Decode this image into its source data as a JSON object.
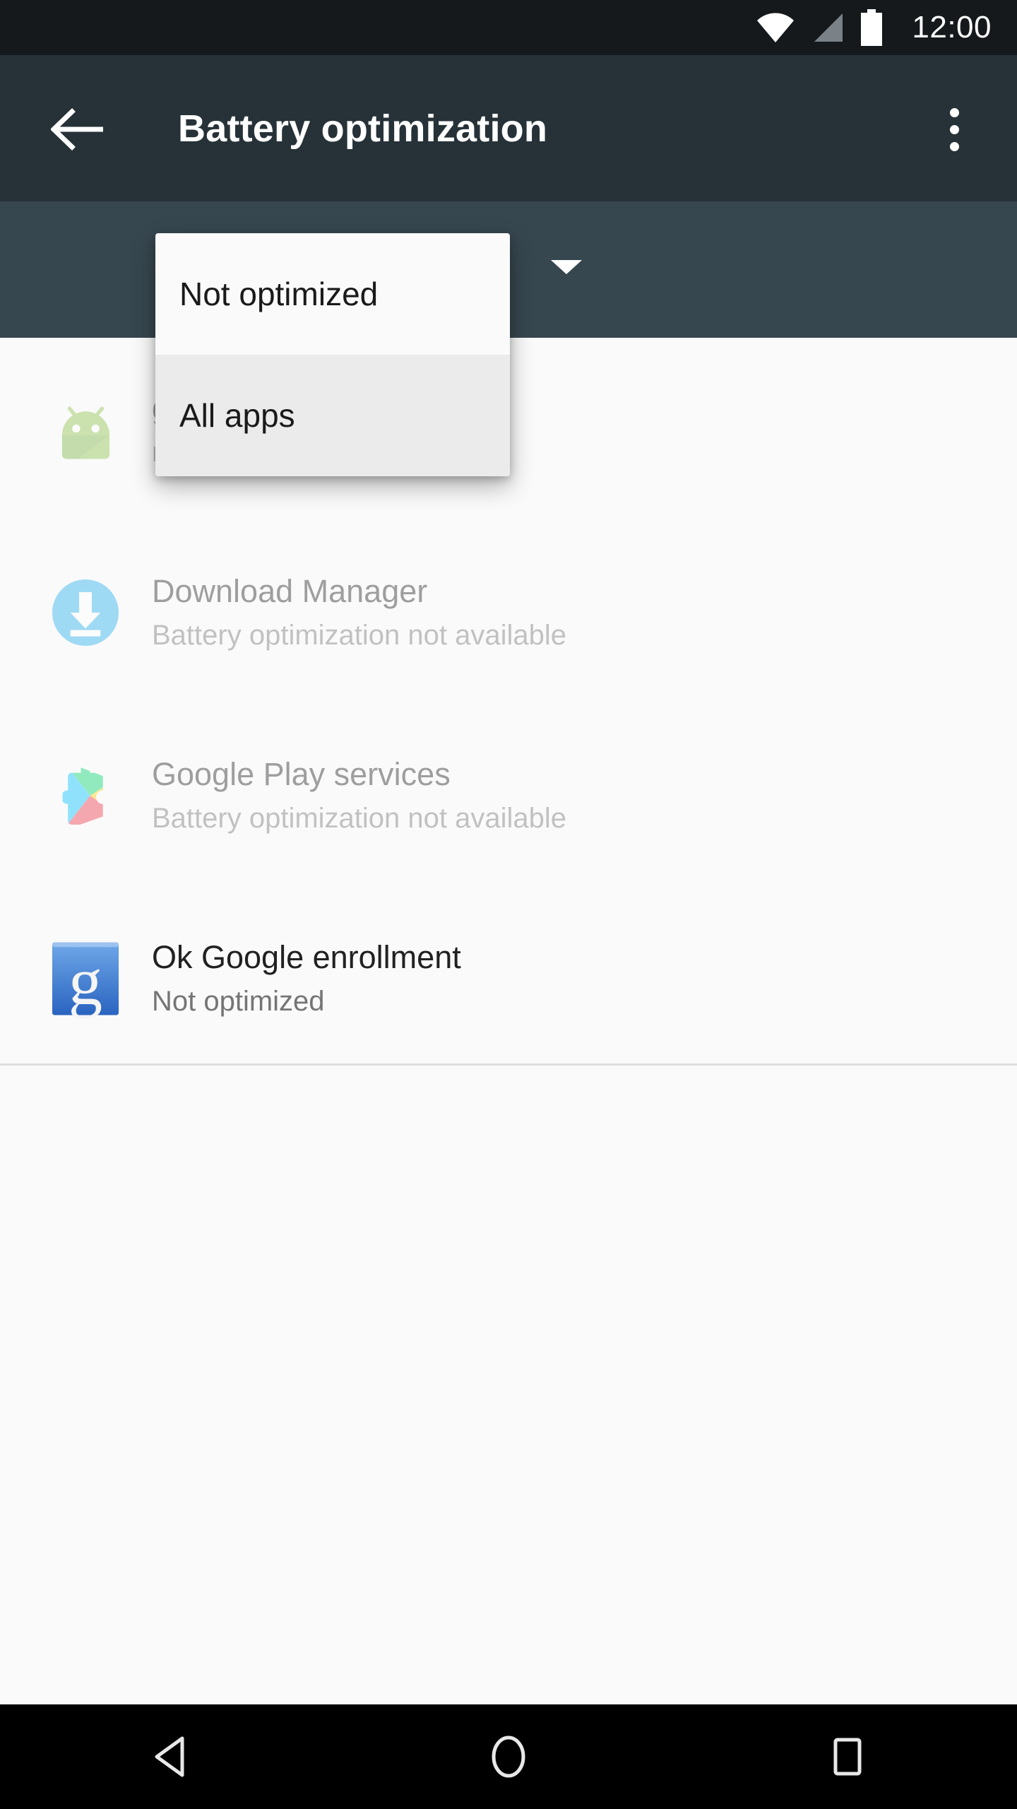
{
  "status_bar": {
    "time": "12:00",
    "icons": [
      "wifi-icon",
      "cellular-signal-icon",
      "battery-icon"
    ],
    "background": "#15191c"
  },
  "toolbar": {
    "title": "Battery optimization",
    "back_icon": "back-arrow-icon",
    "overflow_icon": "overflow-menu-icon",
    "background": "#263238"
  },
  "spinner": {
    "caret_icon": "dropdown-caret-icon",
    "background": "#37474f"
  },
  "dropdown": {
    "items": [
      {
        "label": "Not optimized",
        "selected": false
      },
      {
        "label": "All apps",
        "selected": true
      }
    ]
  },
  "app_list": {
    "rows": [
      {
        "title": "g Service",
        "subtitle": "not available",
        "icon": "android-mascot-icon",
        "dimmed": true
      },
      {
        "title": "Download Manager",
        "subtitle": "Battery optimization not available",
        "icon": "download-manager-icon",
        "dimmed": true
      },
      {
        "title": "Google Play services",
        "subtitle": "Battery optimization not available",
        "icon": "google-play-services-icon",
        "dimmed": true
      },
      {
        "title": "Ok Google enrollment",
        "subtitle": "Not optimized",
        "icon": "google-g-icon",
        "dimmed": false
      }
    ]
  },
  "nav_bar": {
    "back": "nav-back-icon",
    "home": "nav-home-icon",
    "recents": "nav-recents-icon",
    "background": "#000000"
  },
  "colors": {
    "toolbar": "#263238",
    "spinner_bar": "#37474f",
    "content_bg": "#fafafa",
    "divider": "#dedede",
    "title_text": "#212121",
    "subtitle_text": "#757575"
  }
}
